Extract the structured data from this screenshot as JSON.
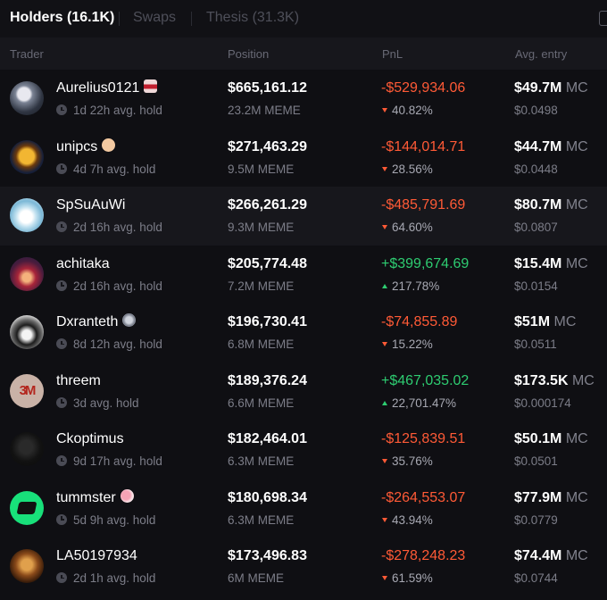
{
  "tabs": [
    {
      "label": "Holders (16.1K)",
      "active": true
    },
    {
      "label": "Swaps",
      "active": false
    },
    {
      "label": "Thesis (31.3K)",
      "active": false
    }
  ],
  "columns": {
    "trader": "Trader",
    "position": "Position",
    "pnl": "PnL",
    "entry": "Avg. entry"
  },
  "mc_unit": "MC",
  "colors": {
    "loss": "#ff5a36",
    "gain": "#2ecc71",
    "background": "#0f0f13"
  },
  "rows": [
    {
      "name": "Aurelius0121",
      "badge_icon": "lips-emoji-icon",
      "hold": "1d 22h avg. hold",
      "position_usd": "$665,161.12",
      "position_tokens": "23.2M MEME",
      "pnl_sign": "-",
      "pnl": "$529,934.06",
      "pnl_pct": "40.82%",
      "mc": "$49.7M",
      "entry": "$0.0498"
    },
    {
      "name": "unipcs",
      "badge_icon": "face-emoji-icon",
      "hold": "4d 7h avg. hold",
      "position_usd": "$271,463.29",
      "position_tokens": "9.5M MEME",
      "pnl_sign": "-",
      "pnl": "$144,014.71",
      "pnl_pct": "28.56%",
      "mc": "$44.7M",
      "entry": "$0.0448"
    },
    {
      "name": "SpSuAuWi",
      "badge_icon": "",
      "hold": "2d 16h avg. hold",
      "position_usd": "$266,261.29",
      "position_tokens": "9.3M MEME",
      "pnl_sign": "-",
      "pnl": "$485,791.69",
      "pnl_pct": "64.60%",
      "mc": "$80.7M",
      "entry": "$0.0807"
    },
    {
      "name": "achitaka",
      "badge_icon": "",
      "hold": "2d 16h avg. hold",
      "position_usd": "$205,774.48",
      "position_tokens": "7.2M MEME",
      "pnl_sign": "+",
      "pnl": "$399,674.69",
      "pnl_pct": "217.78%",
      "mc": "$15.4M",
      "entry": "$0.0154"
    },
    {
      "name": "Dxranteth",
      "badge_icon": "coin-emoji-icon",
      "hold": "8d 12h avg. hold",
      "position_usd": "$196,730.41",
      "position_tokens": "6.8M MEME",
      "pnl_sign": "-",
      "pnl": "$74,855.89",
      "pnl_pct": "15.22%",
      "mc": "$51M",
      "entry": "$0.0511"
    },
    {
      "name": "threem",
      "badge_icon": "",
      "avatar_text": "3M",
      "hold": "3d avg. hold",
      "position_usd": "$189,376.24",
      "position_tokens": "6.6M MEME",
      "pnl_sign": "+",
      "pnl": "$467,035.02",
      "pnl_pct": "22,701.47%",
      "mc": "$173.5K",
      "entry": "$0.000174"
    },
    {
      "name": "Ckoptimus",
      "badge_icon": "",
      "hold": "9d 17h avg. hold",
      "position_usd": "$182,464.01",
      "position_tokens": "6.3M MEME",
      "pnl_sign": "-",
      "pnl": "$125,839.51",
      "pnl_pct": "35.76%",
      "mc": "$50.1M",
      "entry": "$0.0501"
    },
    {
      "name": "tummster",
      "badge_icon": "snail-emoji-icon",
      "hold": "5d 9h avg. hold",
      "position_usd": "$180,698.34",
      "position_tokens": "6.3M MEME",
      "pnl_sign": "-",
      "pnl": "$264,553.07",
      "pnl_pct": "43.94%",
      "mc": "$77.9M",
      "entry": "$0.0779"
    },
    {
      "name": "LA50197934",
      "badge_icon": "",
      "hold": "2d 1h avg. hold",
      "position_usd": "$173,496.83",
      "position_tokens": "6M MEME",
      "pnl_sign": "-",
      "pnl": "$278,248.23",
      "pnl_pct": "61.59%",
      "mc": "$74.4M",
      "entry": "$0.0744"
    }
  ]
}
